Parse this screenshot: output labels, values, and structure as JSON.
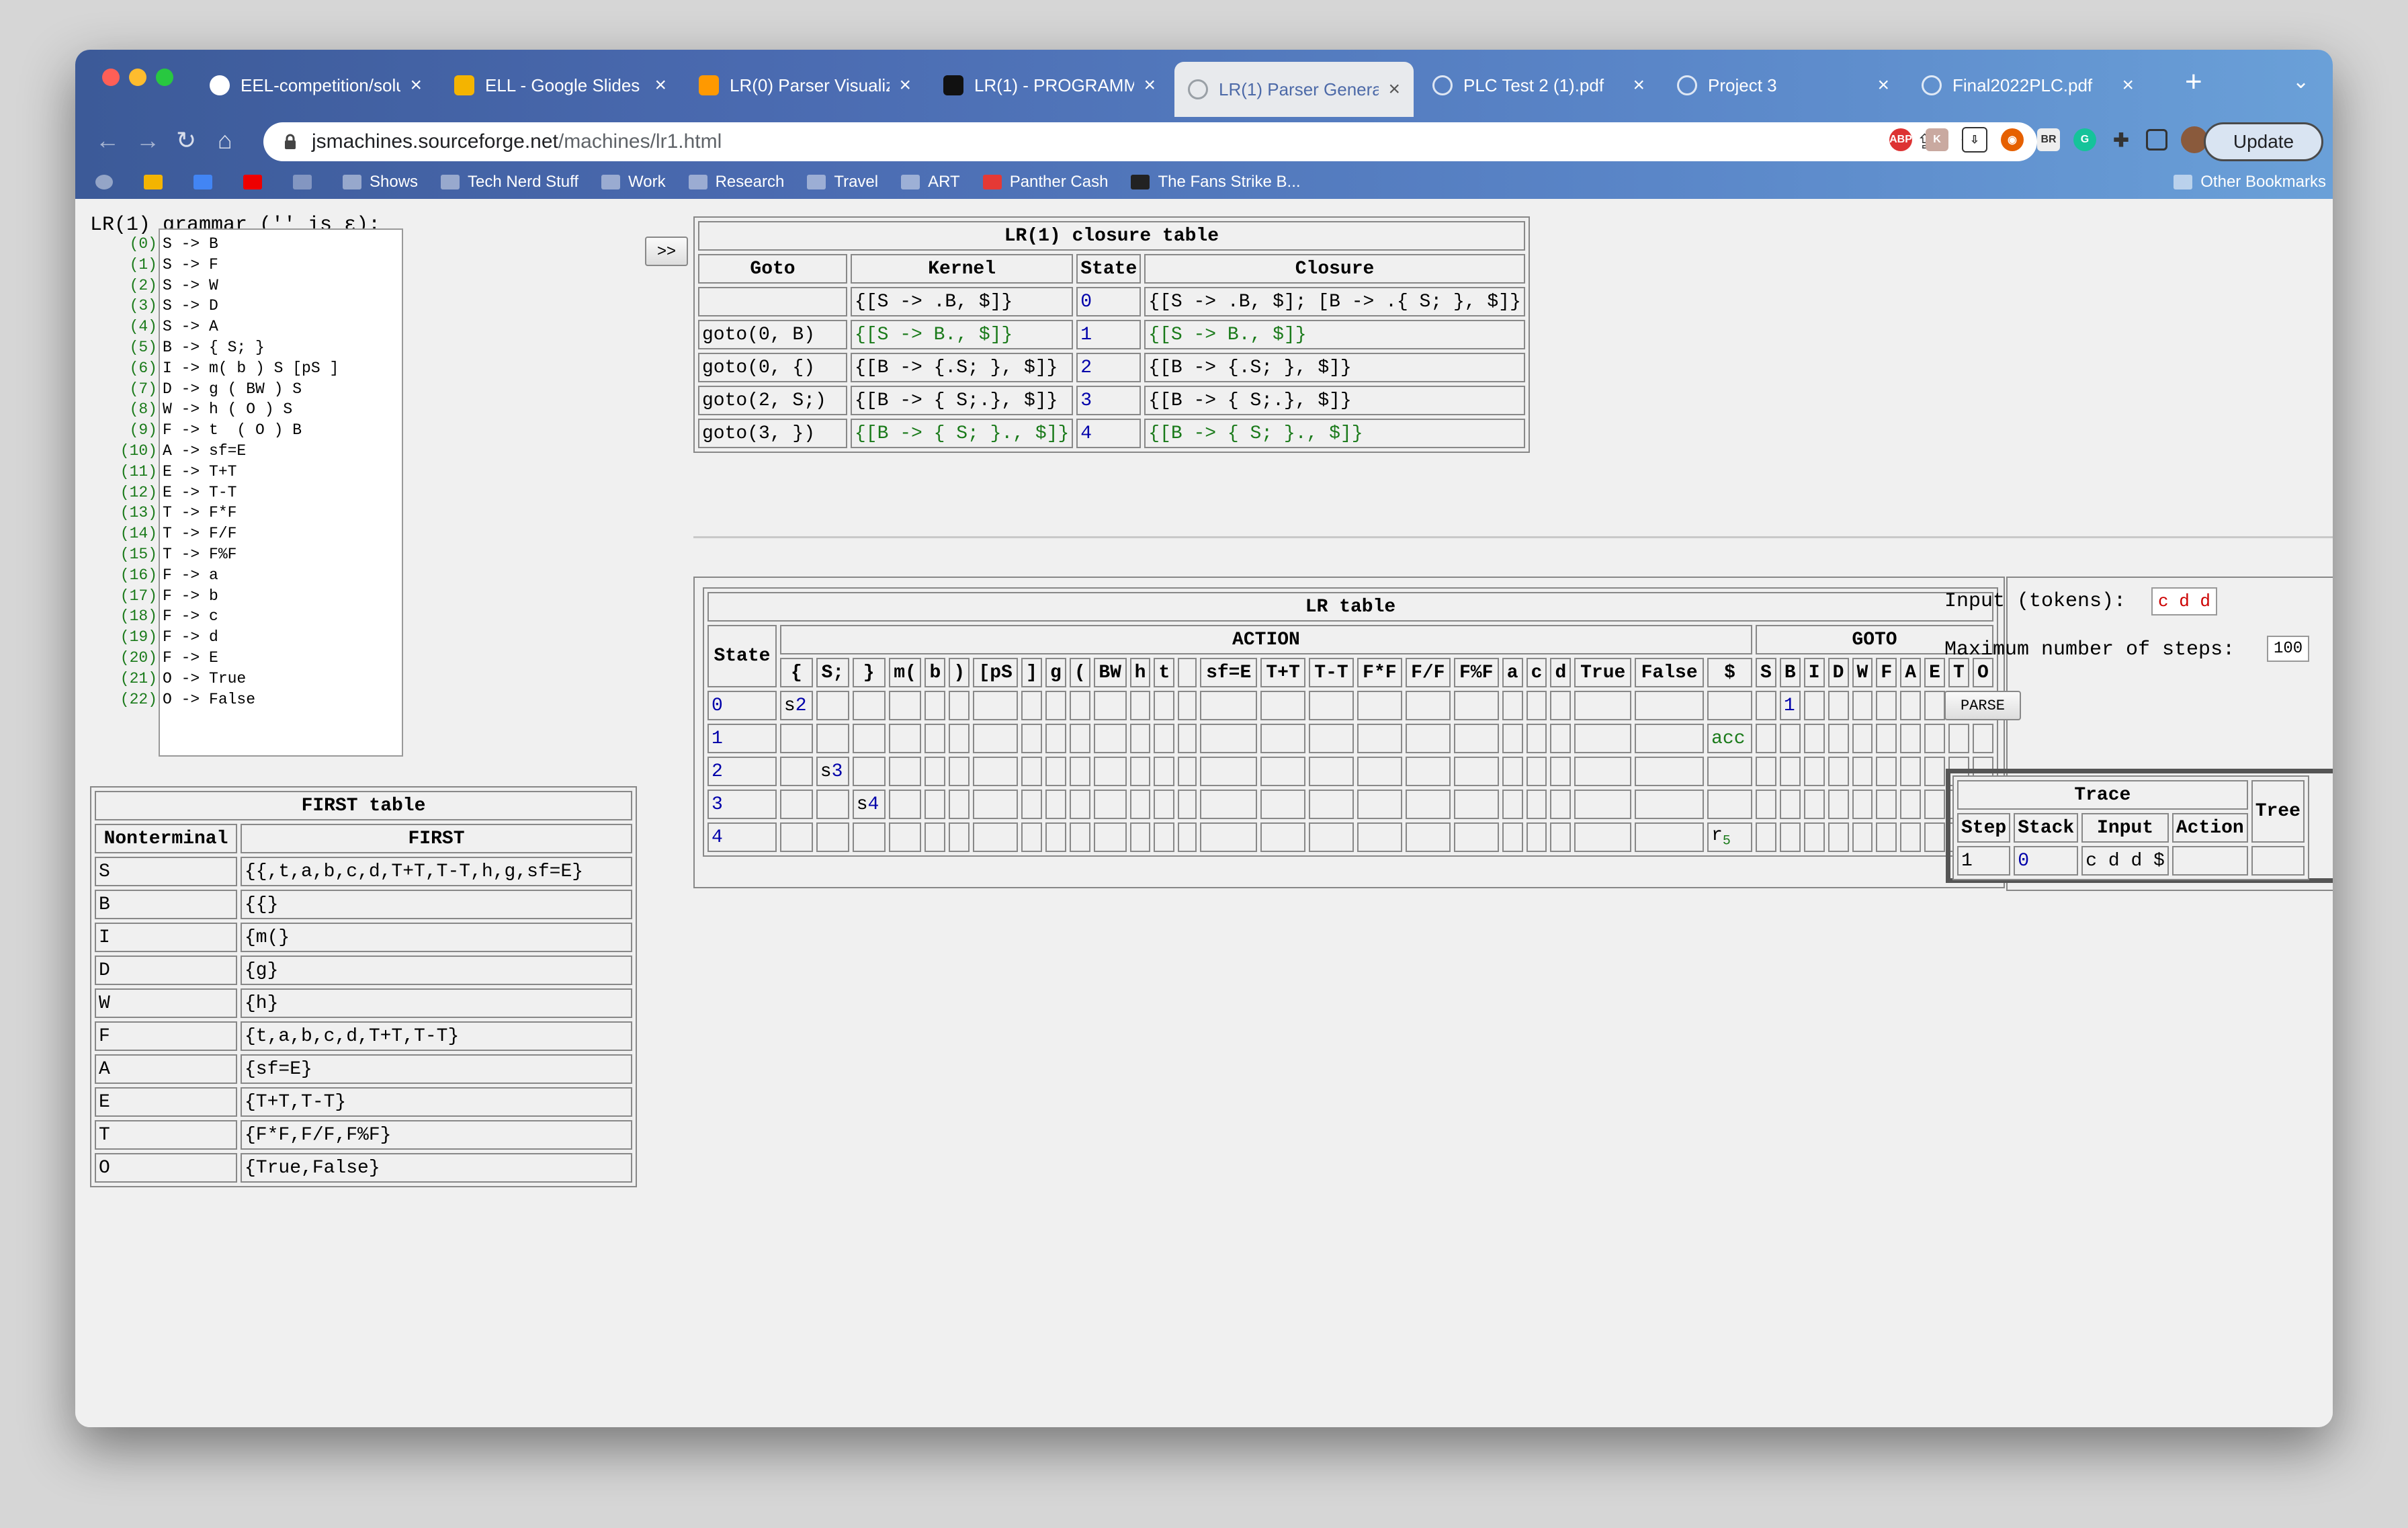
{
  "window": {
    "tabs": [
      {
        "label": "EEL-competition/solu",
        "icon": "github-icon"
      },
      {
        "label": "ELL - Google Slides",
        "icon": "slides-icon"
      },
      {
        "label": "LR(0) Parser Visualiz",
        "icon": "tiger-icon"
      },
      {
        "label": "LR(1) - PROGRAMMI",
        "icon": "d2l-icon"
      },
      {
        "label": "LR(1) Parser Generat",
        "icon": "globe-icon",
        "active": true
      },
      {
        "label": "PLC Test 2 (1).pdf",
        "icon": "globe-icon"
      },
      {
        "label": "Project 3",
        "icon": "globe-icon"
      },
      {
        "label": "Final2022PLC.pdf",
        "icon": "globe-icon"
      }
    ],
    "url": {
      "host": "jsmachines.sourceforge.net",
      "path": "/machines/lr1.html"
    },
    "update_label": "Update",
    "bookmarks": [
      {
        "label": "Shows"
      },
      {
        "label": "Tech Nerd Stuff"
      },
      {
        "label": "Work"
      },
      {
        "label": "Research"
      },
      {
        "label": "Travel"
      },
      {
        "label": "ART"
      },
      {
        "label": "Panther Cash"
      },
      {
        "label": "The Fans Strike B..."
      }
    ],
    "other_bookmarks": "Other Bookmarks",
    "colors": {
      "chrome_left": "#3c5a98",
      "chrome_right": "#6aa0d8",
      "active_tab": "#e8eaed"
    }
  },
  "grammar": {
    "label": "LR(1) grammar ('' is ε):",
    "rules": [
      {
        "n": "(0)",
        "text": "S -> B"
      },
      {
        "n": "(1)",
        "text": "S -> F"
      },
      {
        "n": "(2)",
        "text": "S -> W"
      },
      {
        "n": "(3)",
        "text": "S -> D"
      },
      {
        "n": "(4)",
        "text": "S -> A"
      },
      {
        "n": "(5)",
        "text": "B -> { S; }"
      },
      {
        "n": "(6)",
        "text": "I -> m( b ) S [pS ]"
      },
      {
        "n": "(7)",
        "text": "D -> g ( BW ) S"
      },
      {
        "n": "(8)",
        "text": "W -> h ( O ) S"
      },
      {
        "n": "(9)",
        "text": "F -> t  ( O ) B"
      },
      {
        "n": "(10)",
        "text": "A -> sf=E"
      },
      {
        "n": "(11)",
        "text": "E -> T+T"
      },
      {
        "n": "(12)",
        "text": "E -> T-T"
      },
      {
        "n": "(13)",
        "text": "T -> F*F"
      },
      {
        "n": "(14)",
        "text": "T -> F/F"
      },
      {
        "n": "(15)",
        "text": "T -> F%F"
      },
      {
        "n": "(16)",
        "text": "F -> a"
      },
      {
        "n": "(17)",
        "text": "F -> b"
      },
      {
        "n": "(18)",
        "text": "F -> c"
      },
      {
        "n": "(19)",
        "text": "F -> d"
      },
      {
        "n": "(20)",
        "text": "F -> E"
      },
      {
        "n": "(21)",
        "text": "O -> True"
      },
      {
        "n": "(22)",
        "text": "O -> False"
      }
    ]
  },
  "expand_button": ">>",
  "first_table": {
    "title": "FIRST table",
    "headers": [
      "Nonterminal",
      "FIRST"
    ],
    "rows": [
      [
        "S",
        "{{,t,a,b,c,d,T+T,T-T,h,g,sf=E}"
      ],
      [
        "B",
        "{{}"
      ],
      [
        "I",
        "{m(}"
      ],
      [
        "D",
        "{g}"
      ],
      [
        "W",
        "{h}"
      ],
      [
        "F",
        "{t,a,b,c,d,T+T,T-T}"
      ],
      [
        "A",
        "{sf=E}"
      ],
      [
        "E",
        "{T+T,T-T}"
      ],
      [
        "T",
        "{F*F,F/F,F%F}"
      ],
      [
        "O",
        "{True,False}"
      ]
    ]
  },
  "closure_table": {
    "title": "LR(1) closure table",
    "headers": [
      "Goto",
      "Kernel",
      "State",
      "Closure"
    ],
    "rows": [
      {
        "goto": "",
        "kernel": "{[S -> .B, $]}",
        "state": "0",
        "closure": "{[S -> .B, $]; [B -> .{ S; }, $]}",
        "green": false
      },
      {
        "goto": "goto(0, B)",
        "kernel": "{[S -> B., $]}",
        "state": "1",
        "closure": "{[S -> B., $]}",
        "green": true
      },
      {
        "goto": "goto(0, {)",
        "kernel": "{[B -> {.S; }, $]}",
        "state": "2",
        "closure": "{[B -> {.S; }, $]}",
        "green": false
      },
      {
        "goto": "goto(2, S;)",
        "kernel": "{[B -> { S;.}, $]}",
        "state": "3",
        "closure": "{[B -> { S;.}, $]}",
        "green": false
      },
      {
        "goto": "goto(3, })",
        "kernel": "{[B -> { S; }., $]}",
        "state": "4",
        "closure": "{[B -> { S; }., $]}",
        "green": true
      }
    ]
  },
  "lr_table": {
    "title": "LR table",
    "state_header": "State",
    "action_header": "ACTION",
    "goto_header": "GOTO",
    "action_cols": [
      "{",
      "S;",
      "}",
      "m(",
      "b",
      ")",
      "[pS",
      "]",
      "g",
      "(",
      "BW",
      "h",
      "t",
      "",
      "sf=E",
      "T+T",
      "T-T",
      "F*F",
      "F/F",
      "F%F",
      "a",
      "c",
      "d",
      "True",
      "False",
      "$"
    ],
    "goto_cols": [
      "S",
      "B",
      "I",
      "D",
      "W",
      "F",
      "A",
      "E",
      "T",
      "O"
    ],
    "rows": [
      {
        "state": "0",
        "action": {
          "{": "s2"
        },
        "goto": {
          "B": "1"
        }
      },
      {
        "state": "1",
        "action": {
          "$": "acc"
        },
        "goto": {}
      },
      {
        "state": "2",
        "action": {
          "S;": "s3"
        },
        "goto": {}
      },
      {
        "state": "3",
        "action": {
          "}": "s4"
        },
        "goto": {}
      },
      {
        "state": "4",
        "action": {
          "$": "r5"
        },
        "goto": {}
      }
    ]
  },
  "parser_input": {
    "input_label": "Input (tokens):",
    "input_value": "c d d",
    "steps_label": "Maximum number of steps:",
    "steps_value": "100",
    "parse_label": "PARSE"
  },
  "trace": {
    "title": "Trace",
    "tree_header": "Tree",
    "headers": [
      "Step",
      "Stack",
      "Input",
      "Action"
    ],
    "rows": [
      {
        "step": "1",
        "stack": "0",
        "input": "c d d $",
        "action": ""
      }
    ]
  }
}
